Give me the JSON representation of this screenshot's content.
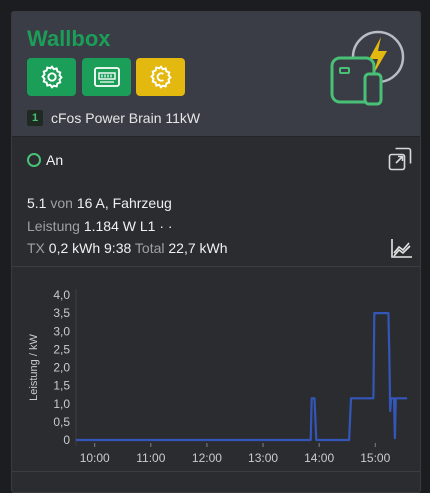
{
  "header": {
    "title": "Wallbox",
    "buttons": [
      {
        "icon": "gear-icon",
        "color": "#1a9e58"
      },
      {
        "icon": "meter-icon",
        "color": "#1a9e58"
      },
      {
        "icon": "settings-clock-icon",
        "color": "#e3b80f"
      }
    ],
    "device": {
      "index": "1",
      "name": "cFos Power Brain 11kW"
    },
    "charger_icon": "wallbox-charging-icon"
  },
  "status": {
    "text": "An",
    "state_color": "#48c176"
  },
  "info": {
    "line1": {
      "current": "5.1",
      "von": "von",
      "max": "16 A, Fahrzeug"
    },
    "line2": {
      "label": "Leistung",
      "value": "1.184 W L1 · ·"
    },
    "line3": {
      "tx_label": "TX",
      "tx_value": "0,2 kWh 9:38",
      "total_label": "Total",
      "total_value": "22,7 kWh"
    }
  },
  "chart_data": {
    "type": "line",
    "ylabel": "Leistung / kW",
    "xlabel": "",
    "yticks": [
      "4,0",
      "3,5",
      "3,0",
      "2,5",
      "2,0",
      "1,5",
      "1,0",
      "0,5",
      "0"
    ],
    "xticks": [
      "10:00",
      "11:00",
      "12:00",
      "13:00",
      "14:00",
      "15:00"
    ],
    "ylim": [
      0,
      4
    ],
    "xlim": [
      "09:40",
      "15:35"
    ],
    "grid": false,
    "series": [
      {
        "color": "#3356b8",
        "points": [
          [
            "09:40",
            0
          ],
          [
            "13:51",
            0
          ],
          [
            "13:52",
            1.15
          ],
          [
            "13:55",
            1.15
          ],
          [
            "13:57",
            0
          ],
          [
            "14:32",
            0
          ],
          [
            "14:34",
            1.15
          ],
          [
            "14:58",
            1.15
          ],
          [
            "14:59",
            3.5
          ],
          [
            "15:14",
            3.5
          ],
          [
            "15:15",
            2.4
          ],
          [
            "15:16",
            0.8
          ],
          [
            "15:17",
            1.15
          ],
          [
            "15:20",
            1.15
          ],
          [
            "15:21",
            0.05
          ],
          [
            "15:22",
            1.15
          ],
          [
            "15:34",
            1.15
          ]
        ]
      }
    ]
  }
}
